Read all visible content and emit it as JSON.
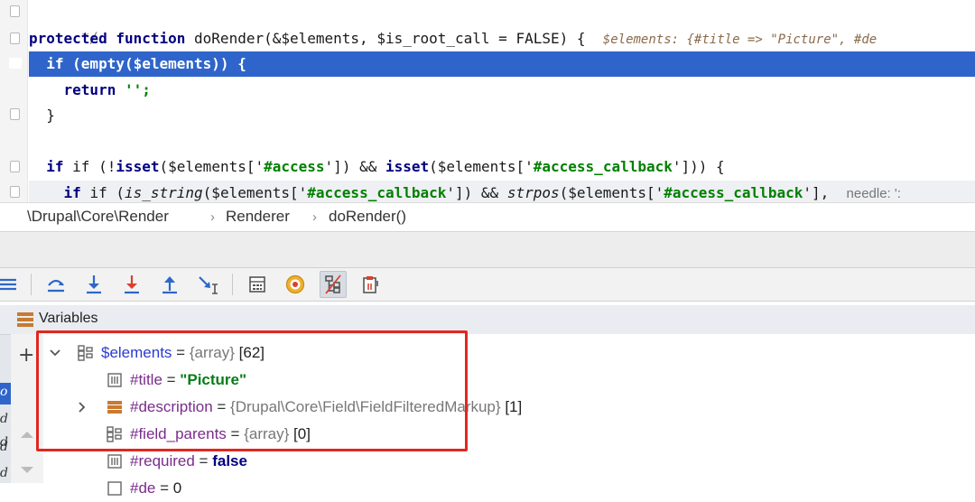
{
  "editor": {
    "lines": {
      "l0": "*/",
      "l1_kw": "protected function",
      "l1_name": "doRender",
      "l1_params": "(&$elements, $is_root_call = FALSE) {",
      "l1_inline": "$elements: {#title => \"Picture\", #de",
      "l2": "if (empty($elements)) {",
      "l3_kw": "return",
      "l3_str": "'';",
      "l4": "}",
      "l6_pre": "if (!",
      "l6_fn1": "isset",
      "l6_mid1": "($elements['",
      "l6_key1": "#access",
      "l6_mid2": "']) && ",
      "l6_fn2": "isset",
      "l6_mid3": "($elements['",
      "l6_key2": "#access_callback",
      "l6_end": "'])) {",
      "l7_pre": "if (",
      "l7_fn1": "is_string",
      "l7_mid1": "($elements['",
      "l7_key1": "#access_callback",
      "l7_mid2": "']) && ",
      "l7_fn2": "strpos",
      "l7_mid3": "($elements['",
      "l7_key2": "#access_callback",
      "l7_end": "'],",
      "l7_inline": "needle: ':"
    }
  },
  "breadcrumb": {
    "items": [
      "\\Drupal\\Core\\Render",
      "Renderer",
      "doRender()"
    ],
    "separator": "›"
  },
  "toolbar": {
    "buttons": [
      "menu-icon",
      "step-over-icon",
      "step-into-icon",
      "force-step-into-icon",
      "step-out-icon",
      "run-to-cursor-icon",
      "evaluate-expression-icon",
      "watch-icon",
      "restore-layout-icon",
      "copy-stack-icon"
    ]
  },
  "variables": {
    "title": "Variables",
    "rows": [
      {
        "name": "$elements",
        "eq": " = ",
        "type": "{array}",
        "count": "[62]"
      },
      {
        "name": "#title",
        "eq": " = ",
        "value": "\"Picture\""
      },
      {
        "name": "#description",
        "eq": " = ",
        "type": "{Drupal\\Core\\Field\\FieldFilteredMarkup}",
        "count": "[1]"
      },
      {
        "name": "#field_parents",
        "eq": " = ",
        "type": "{array}",
        "count": "[0]"
      },
      {
        "name": "#required",
        "eq": " = ",
        "value": "false"
      },
      {
        "name": "#de",
        "eq": " = ",
        "value": "0"
      }
    ]
  },
  "frames": [
    "o",
    "d",
    "d",
    "d",
    "d"
  ],
  "colors": {
    "highlight": "#2f65ca",
    "annotation_box": "#e0281f"
  }
}
